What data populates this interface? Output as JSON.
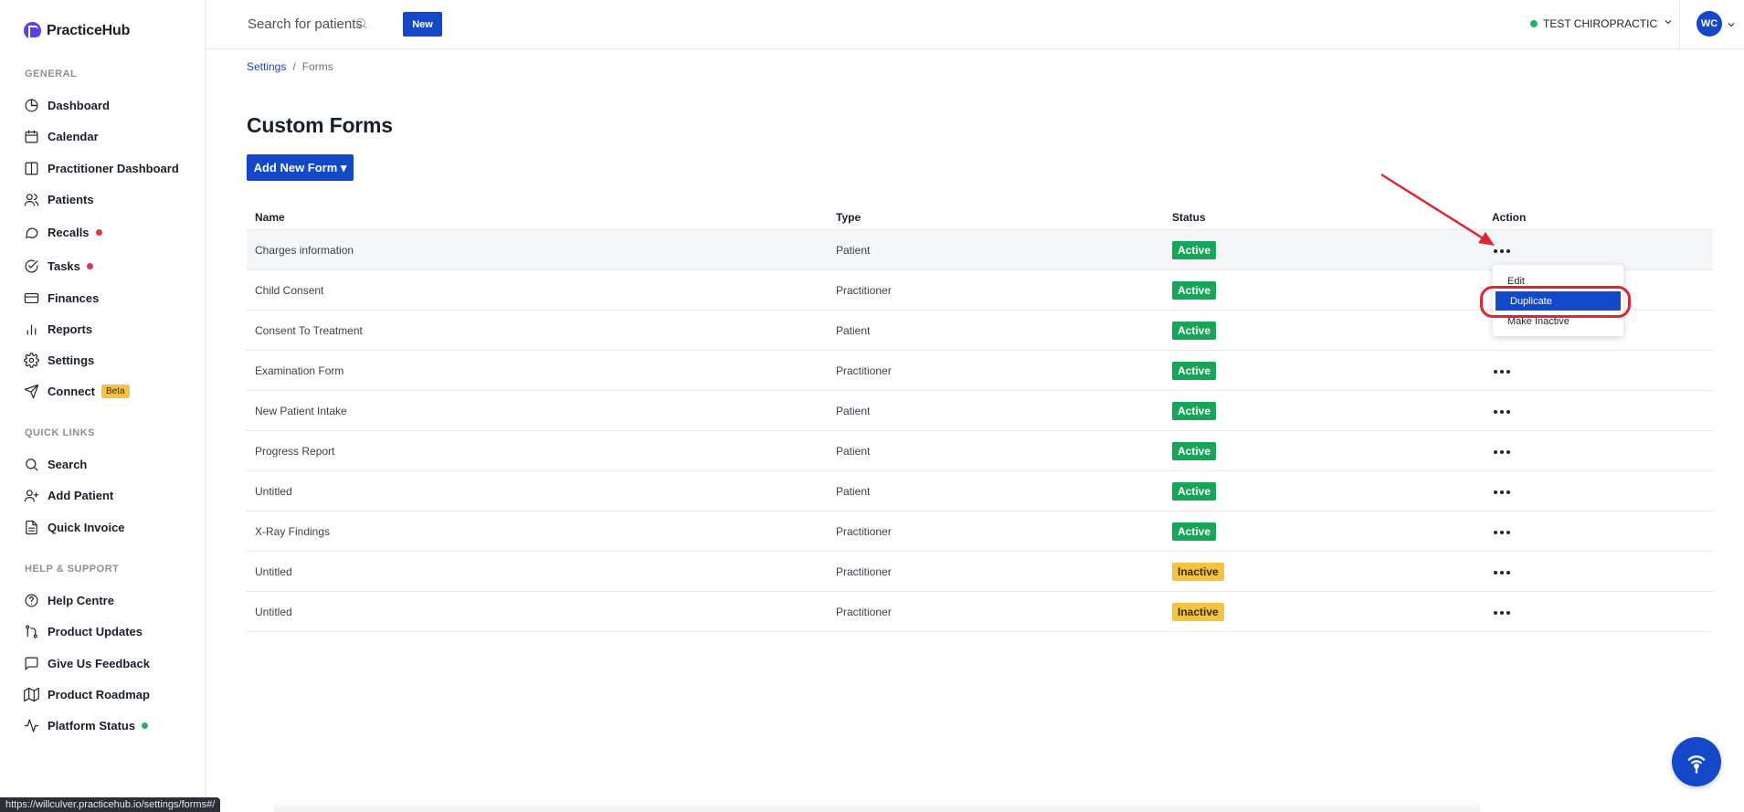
{
  "app": {
    "name": "PracticeHub",
    "brand_color": "#5b3fe0",
    "accent_color": "#1348c9"
  },
  "sidebar": {
    "sections": {
      "general": "GENERAL",
      "quick_links": "QUICK LINKS",
      "help": "HELP & SUPPORT"
    },
    "items": [
      {
        "label": "Dashboard",
        "icon": "pie-chart-icon"
      },
      {
        "label": "Calendar",
        "icon": "calendar-icon"
      },
      {
        "label": "Practitioner Dashboard",
        "icon": "columns-icon"
      },
      {
        "label": "Patients",
        "icon": "users-icon"
      },
      {
        "label": "Recalls",
        "icon": "chat-icon"
      },
      {
        "label": "Tasks",
        "icon": "check-circle-icon"
      },
      {
        "label": "Finances",
        "icon": "credit-card-icon"
      },
      {
        "label": "Reports",
        "icon": "bar-chart-icon"
      },
      {
        "label": "Settings",
        "icon": "gear-icon"
      },
      {
        "label": "Connect",
        "icon": "send-icon",
        "badge": "Beta"
      }
    ],
    "quick_links": [
      {
        "label": "Search",
        "icon": "search-icon"
      },
      {
        "label": "Add Patient",
        "icon": "add-user-icon"
      },
      {
        "label": "Quick Invoice",
        "icon": "document-icon"
      }
    ],
    "help": [
      {
        "label": "Help Centre",
        "icon": "help-circle-icon"
      },
      {
        "label": "Product Updates",
        "icon": "git-icon"
      },
      {
        "label": "Give Us Feedback",
        "icon": "chat-icon"
      },
      {
        "label": "Product Roadmap",
        "icon": "map-icon"
      },
      {
        "label": "Platform Status",
        "icon": "activity-icon"
      }
    ]
  },
  "topbar": {
    "search_placeholder": "Search for patients",
    "new_label": "New",
    "clinic_name": "TEST CHIROPRACTIC",
    "avatar_initials": "WC"
  },
  "breadcrumb": {
    "parent": "Settings",
    "separator": "/",
    "current": "Forms"
  },
  "page": {
    "title": "Custom Forms",
    "add_button": "Add New Form ▾"
  },
  "table": {
    "headers": {
      "name": "Name",
      "type": "Type",
      "status": "Status",
      "action": "Action"
    },
    "rows": [
      {
        "name": "Charges information",
        "type": "Patient",
        "status": "Active"
      },
      {
        "name": "Child Consent",
        "type": "Practitioner",
        "status": "Active"
      },
      {
        "name": "Consent To Treatment",
        "type": "Patient",
        "status": "Active"
      },
      {
        "name": "Examination Form",
        "type": "Practitioner",
        "status": "Active"
      },
      {
        "name": "New Patient Intake",
        "type": "Patient",
        "status": "Active"
      },
      {
        "name": "Progress Report",
        "type": "Patient",
        "status": "Active"
      },
      {
        "name": "Untitled",
        "type": "Patient",
        "status": "Active"
      },
      {
        "name": "X-Ray Findings",
        "type": "Practitioner",
        "status": "Active"
      },
      {
        "name": "Untitled",
        "type": "Practitioner",
        "status": "Inactive"
      },
      {
        "name": "Untitled",
        "type": "Practitioner",
        "status": "Inactive"
      }
    ]
  },
  "action_menu": {
    "items": [
      "Edit",
      "Duplicate",
      "Make Inactive"
    ],
    "selected": "Duplicate"
  },
  "status_bar_url": "https://willculver.practicehub.io/settings/forms#/",
  "fab_icon": "wifi-broadcast-icon"
}
